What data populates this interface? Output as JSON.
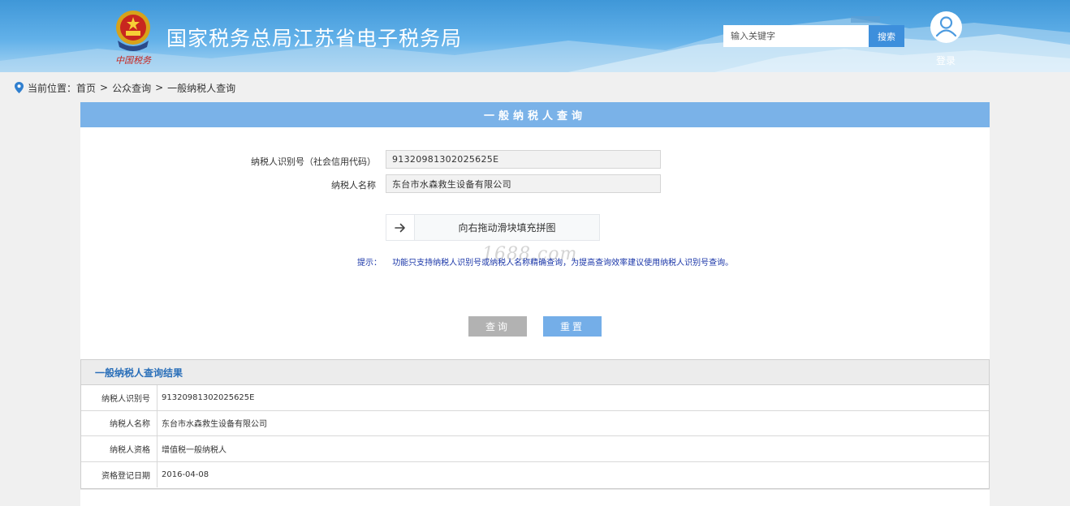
{
  "header": {
    "site_title": "国家税务总局江苏省电子税务局",
    "emblem_caption": "中国税务",
    "search_placeholder": "输入关键字",
    "search_button": "搜索",
    "login_label": "登录"
  },
  "breadcrumb": {
    "prefix": "当前位置：",
    "items": [
      "首页",
      "公众查询",
      "一般纳税人查询"
    ],
    "separator": ">"
  },
  "form": {
    "title": "一般纳税人查询",
    "taxpayer_id_label": "纳税人识别号（社会信用代码）",
    "taxpayer_id_value": "91320981302025625E",
    "taxpayer_name_label": "纳税人名称",
    "taxpayer_name_value": "东台市水森救生设备有限公司",
    "slider_text": "向右拖动滑块填充拼图",
    "hint_label": "提示：",
    "hint_text": "功能只支持纳税人识别号或纳税人名称精确查询，为提高查询效率建议使用纳税人识别号查询。",
    "watermark": "1688.com",
    "query_button": "查询",
    "reset_button": "重置"
  },
  "results": {
    "title": "一般纳税人查询结果",
    "rows": [
      {
        "key": "纳税人识别号",
        "value": "91320981302025625E"
      },
      {
        "key": "纳税人名称",
        "value": "东台市水森救生设备有限公司"
      },
      {
        "key": "纳税人资格",
        "value": "增值税一般纳税人"
      },
      {
        "key": "资格登记日期",
        "value": "2016-04-08"
      }
    ]
  },
  "colors": {
    "header_blue": "#3f97d8",
    "panel_head": "#7ab2e8",
    "query_button": "#b2b2b2",
    "reset_button": "#74aee8",
    "hint_text": "#1a36a8",
    "results_title": "#2a6fb9"
  },
  "icons": {
    "emblem": "national-emblem-icon",
    "user": "user-avatar-icon",
    "location": "location-pin-icon",
    "slider": "arrow-right-icon"
  }
}
